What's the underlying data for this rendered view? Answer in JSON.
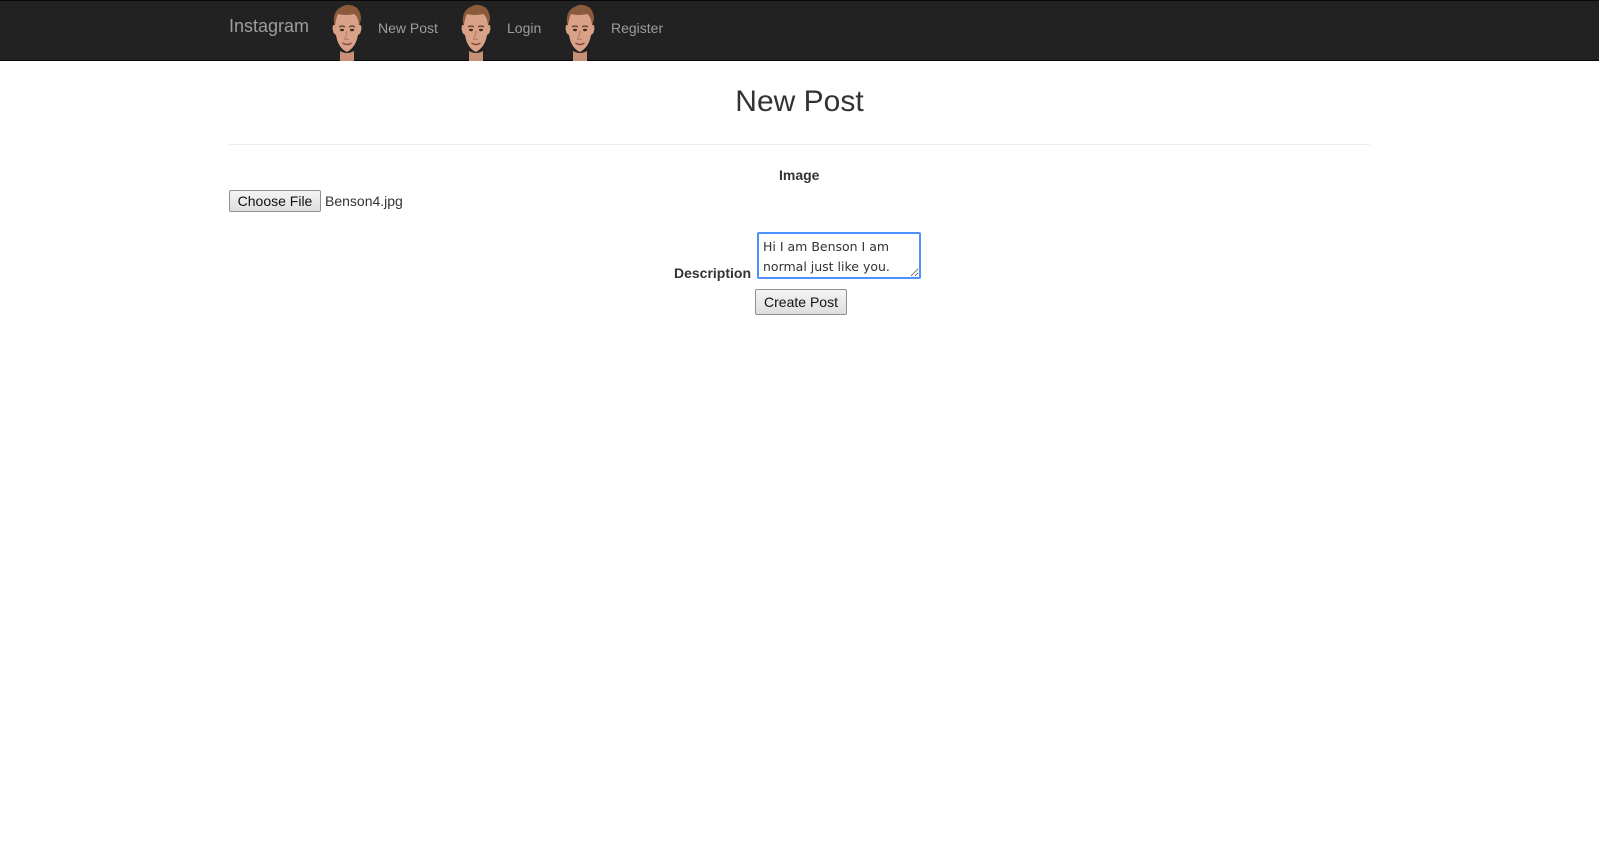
{
  "nav": {
    "brand": "Instagram",
    "items": [
      {
        "label": "New Post",
        "icon": "avatar-icon"
      },
      {
        "label": "Login",
        "icon": "avatar-icon"
      },
      {
        "label": "Register",
        "icon": "avatar-icon"
      }
    ],
    "background_color": "#222222",
    "link_color": "#9d9d9d"
  },
  "page": {
    "title": "New Post"
  },
  "form": {
    "image_label": "Image",
    "file_button_label": "Choose File",
    "file_name": "Benson4.jpg",
    "description_label": "Description",
    "description_value": "Hi I am Benson I am normal just like you.",
    "submit_label": "Create Post",
    "focus_color": "#4d90fe"
  }
}
